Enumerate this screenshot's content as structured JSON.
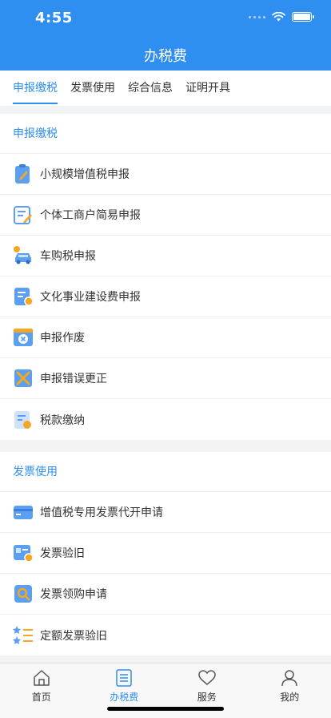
{
  "status": {
    "time": "4:55"
  },
  "header": {
    "title": "办税费"
  },
  "tabs": [
    {
      "label": "申报缴税",
      "active": true
    },
    {
      "label": "发票使用",
      "active": false
    },
    {
      "label": "综合信息",
      "active": false
    },
    {
      "label": "证明开具",
      "active": false
    }
  ],
  "sections": [
    {
      "title": "申报缴税",
      "items": [
        {
          "label": "小规模增值税申报",
          "icon": "clipboard-pen-icon"
        },
        {
          "label": "个体工商户简易申报",
          "icon": "form-edit-icon"
        },
        {
          "label": "车购税申报",
          "icon": "car-icon"
        },
        {
          "label": "文化事业建设费申报",
          "icon": "document-coin-icon"
        },
        {
          "label": "申报作废",
          "icon": "cancel-window-icon"
        },
        {
          "label": "申报错误更正",
          "icon": "cross-correct-icon"
        },
        {
          "label": "税款缴纳",
          "icon": "tax-payment-icon"
        }
      ]
    },
    {
      "title": "发票使用",
      "items": [
        {
          "label": "增值税专用发票代开申请",
          "icon": "card-icon"
        },
        {
          "label": "发票验旧",
          "icon": "invoice-verify-icon"
        },
        {
          "label": "发票领购申请",
          "icon": "invoice-search-icon"
        },
        {
          "label": "定额发票验旧",
          "icon": "star-list-icon"
        }
      ]
    }
  ],
  "bottom_nav": [
    {
      "label": "首页",
      "icon": "home-icon",
      "active": false
    },
    {
      "label": "办税费",
      "icon": "list-icon",
      "active": true
    },
    {
      "label": "服务",
      "icon": "heart-icon",
      "active": false
    },
    {
      "label": "我的",
      "icon": "user-icon",
      "active": false
    }
  ],
  "colors": {
    "primary": "#2e8ff0",
    "icon_blue": "#5b9ff2",
    "icon_orange": "#f5a623",
    "background": "#f2f3f5"
  }
}
